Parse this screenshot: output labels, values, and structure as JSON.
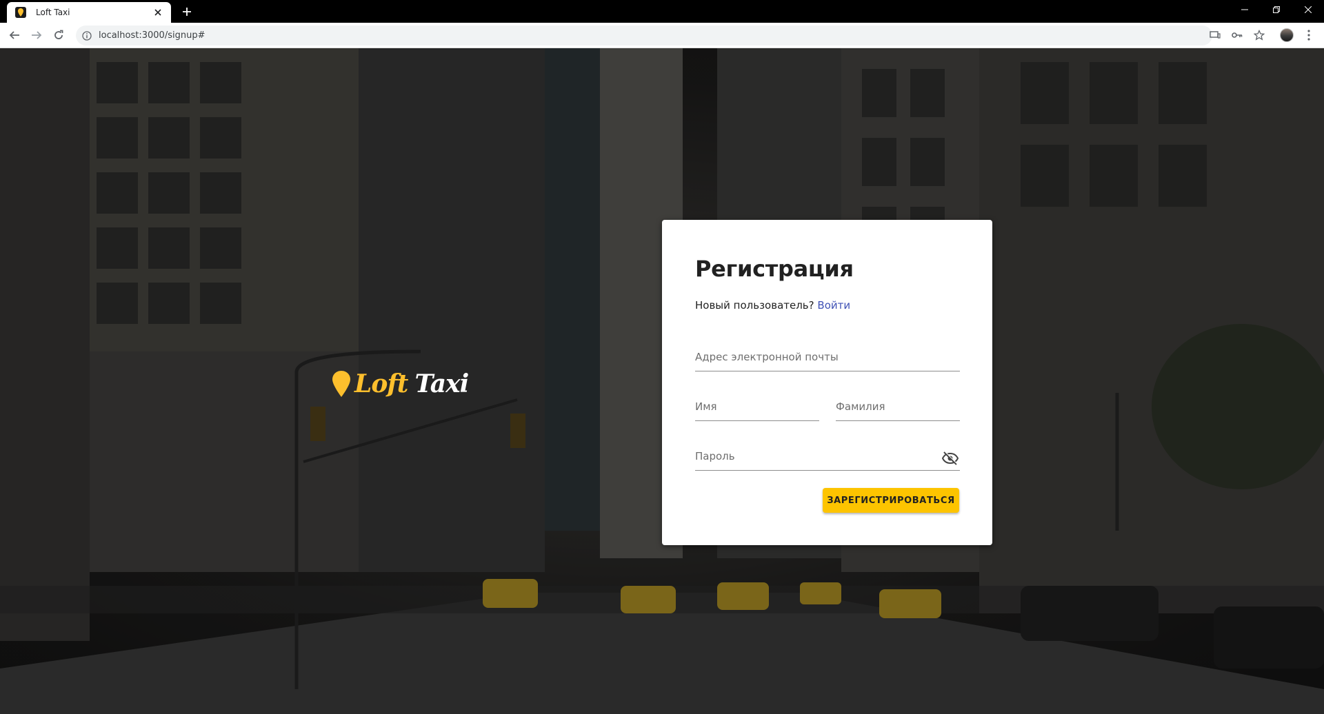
{
  "browser": {
    "tab_title": "Loft Taxi",
    "url": "localhost:3000/signup#"
  },
  "logo": {
    "loft": "Loft",
    "taxi": "Taxi"
  },
  "form": {
    "title": "Регистрация",
    "subtitle": "Новый пользователь?",
    "login_link": "Войти",
    "email_placeholder": "Адрес электронной почты",
    "first_name_placeholder": "Имя",
    "last_name_placeholder": "Фамилия",
    "password_placeholder": "Пароль",
    "submit_label": "ЗАРЕГИСТРИРОВАТЬСЯ"
  },
  "colors": {
    "accent": "#fdc400",
    "link": "#3f51b5",
    "logo_yellow": "#fdbf2d"
  }
}
